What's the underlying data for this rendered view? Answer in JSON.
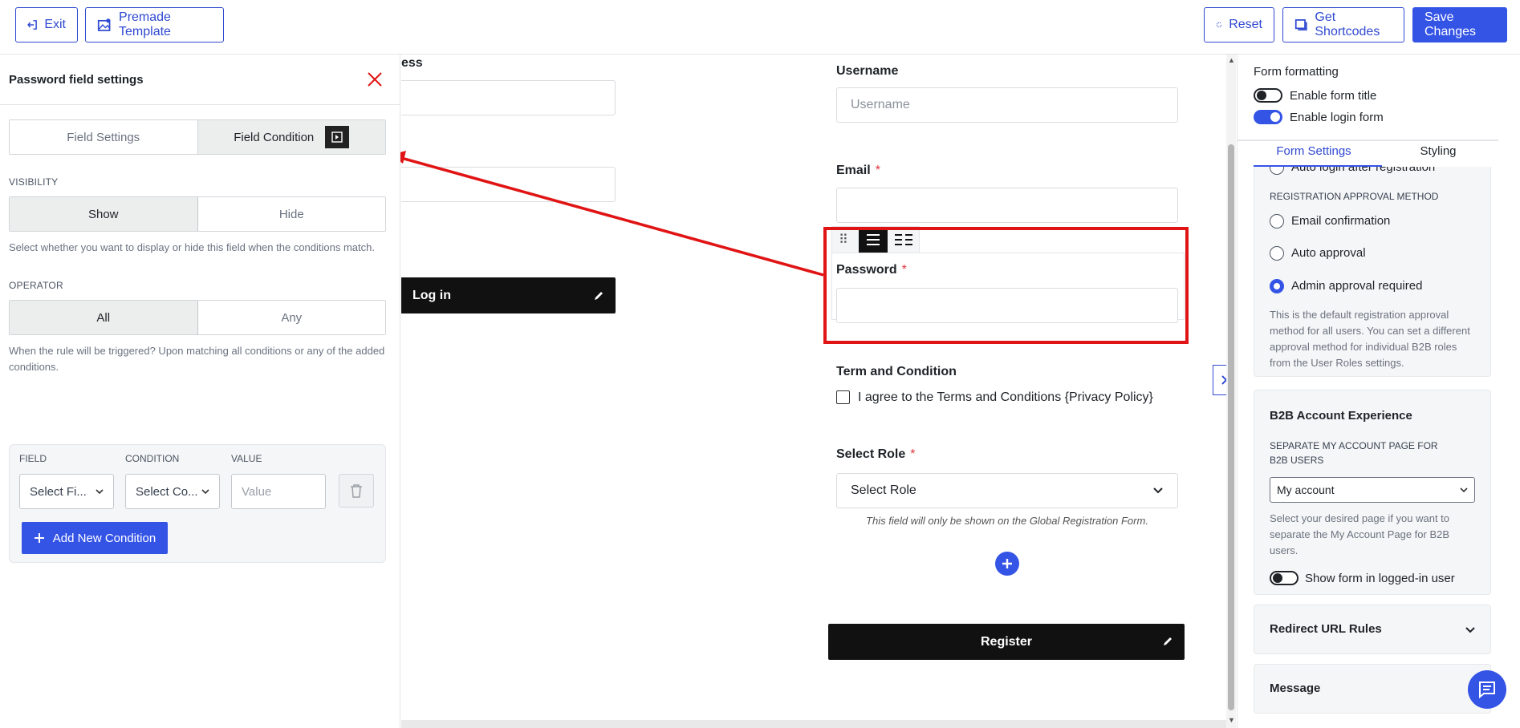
{
  "topbar": {
    "exit_label": "Exit",
    "premade_label": "Premade Template",
    "reset_label": "Reset",
    "shortcodes_label": "Get Shortcodes",
    "save_label": "Save Changes"
  },
  "left_panel": {
    "title": "Password field settings",
    "tabs": [
      "Field Settings",
      "Field Condition"
    ],
    "active_tab": "Field Condition",
    "visibility": {
      "caption": "VISIBILITY",
      "options": [
        "Show",
        "Hide"
      ],
      "selected": "Show",
      "help": "Select whether you want to display or hide this field when the conditions match."
    },
    "operator": {
      "caption": "OPERATOR",
      "options": [
        "All",
        "Any"
      ],
      "selected": "All",
      "help": "When the rule will be triggered? Upon matching all conditions or any of the added conditions."
    },
    "condition": {
      "field_header": "FIELD",
      "condition_header": "CONDITION",
      "value_header": "VALUE",
      "field_value": "Select Fi...",
      "condition_value": "Select Co...",
      "value_placeholder": "Value",
      "add_button": "Add New Condition"
    }
  },
  "canvas": {
    "partial_label": "ess",
    "login_button": "Log in",
    "username_label": "Username",
    "username_placeholder": "Username",
    "email_label": "Email",
    "password_label": "Password",
    "required_mark": "*",
    "terms_label": "Term and Condition",
    "terms_text": "I agree to the Terms and Conditions {Privacy Policy}",
    "role_label": "Select Role",
    "role_value": "Select Role",
    "role_note": "This field will only be shown on the Global Registration Form.",
    "register_button": "Register",
    "highlight_color": "#e01414"
  },
  "right_panel": {
    "formatting_title": "Form formatting",
    "toggle_title_label": "Enable form title",
    "toggle_title_on": false,
    "toggle_login_label": "Enable login form",
    "toggle_login_on": true,
    "tabs": [
      "Form Settings",
      "Styling"
    ],
    "active_tab": "Form Settings",
    "cut_option": "Auto login after registration",
    "approval_caption": "REGISTRATION APPROVAL METHOD",
    "approval_options": [
      "Email confirmation",
      "Auto approval",
      "Admin approval required"
    ],
    "approval_selected": "Admin approval required",
    "approval_help": "This is the default registration approval method for all users. You can set a different approval method for individual B2B roles from the User Roles settings.",
    "b2b_title": "B2B Account Experience",
    "b2b_caption": "SEPARATE MY ACCOUNT PAGE FOR B2B USERS",
    "b2b_select": "My account",
    "b2b_help": "Select your desired page if you want to separate the My Account Page for B2B users.",
    "show_logged_label": "Show form in logged-in user",
    "show_logged_on": false,
    "redirect_title": "Redirect URL Rules",
    "message_title": "Message"
  },
  "colors": {
    "accent": "#3454e6",
    "highlight": "#e01414"
  }
}
